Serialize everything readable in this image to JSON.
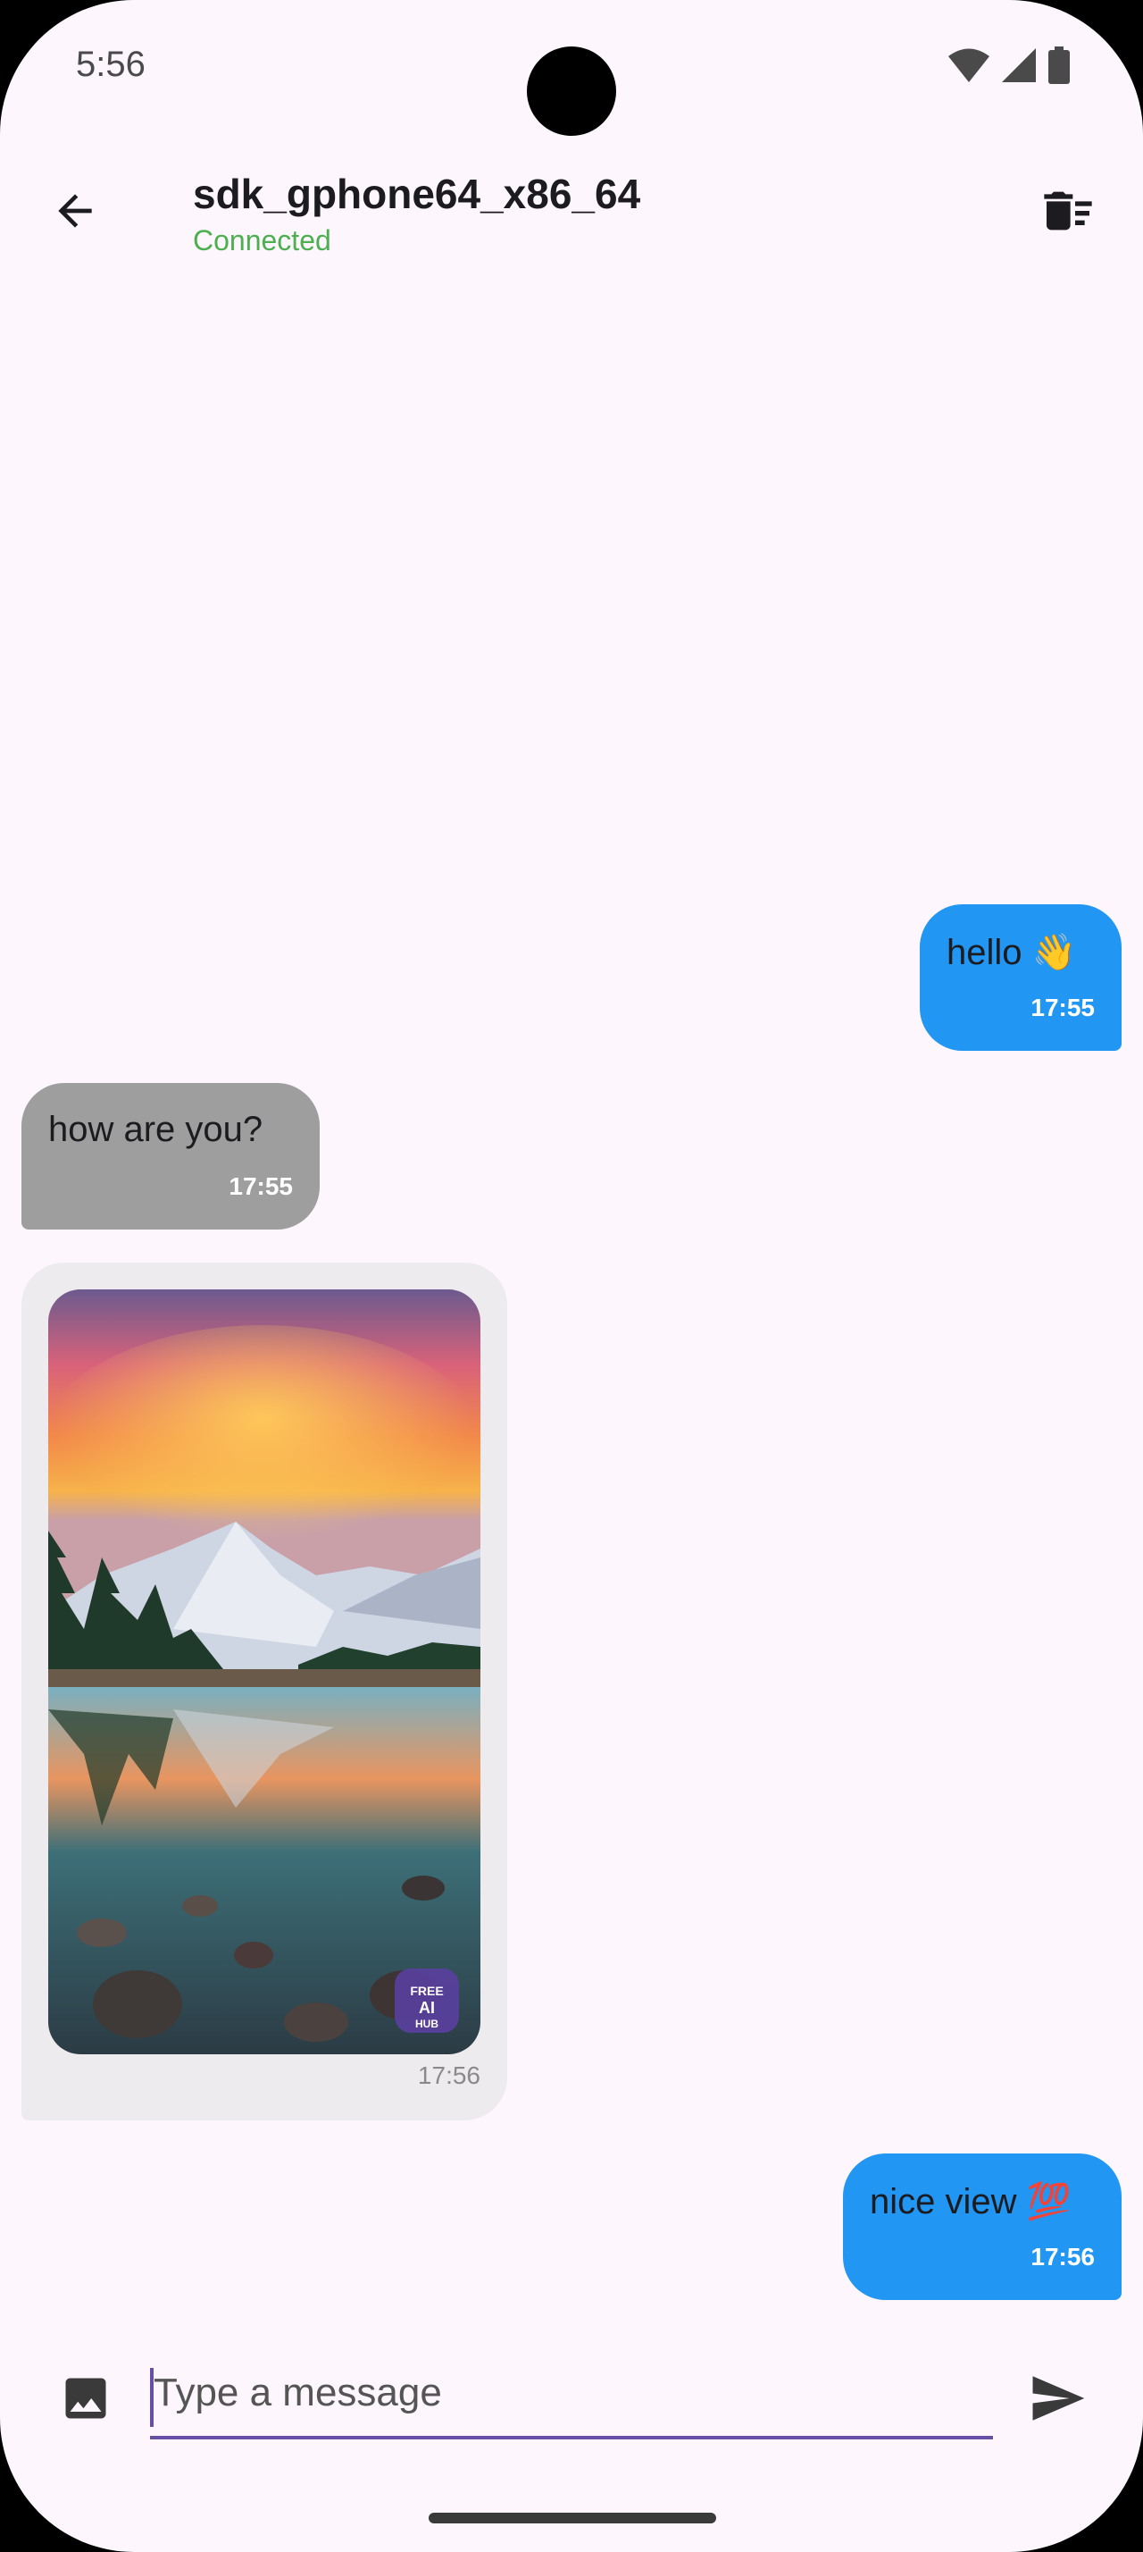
{
  "status_bar": {
    "time": "5:56",
    "icons": [
      "wifi-icon",
      "signal-icon",
      "battery-icon"
    ]
  },
  "app_bar": {
    "back_icon": "arrow-back-icon",
    "title": "sdk_gphone64_x86_64",
    "status": "Connected",
    "clear_icon": "delete-sweep-icon"
  },
  "colors": {
    "sent_bubble": "#2196F3",
    "received_bubble": "#9E9E9E",
    "image_bubble": "#EEEBEF",
    "connected": "#4CAF50",
    "accent": "#6750A4",
    "background": "#FDF6FC"
  },
  "messages": [
    {
      "direction": "sent",
      "text": "hello 👋",
      "time": "17:55"
    },
    {
      "direction": "received",
      "text": "how are you?",
      "time": "17:55"
    },
    {
      "direction": "received",
      "type": "image",
      "image_description": "mountain-lake-sunset-photo",
      "watermark": "FREE AI HUB",
      "time": "17:56"
    },
    {
      "direction": "sent",
      "text": "nice view 💯",
      "time": "17:56"
    }
  ],
  "composer": {
    "attach_icon": "image-icon",
    "placeholder": "Type a message",
    "value": "",
    "send_icon": "send-icon"
  }
}
